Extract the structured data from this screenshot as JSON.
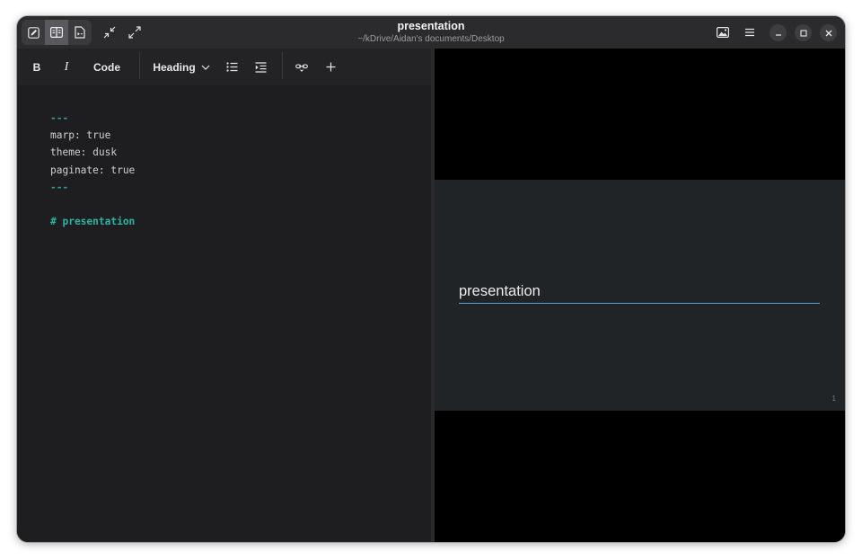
{
  "window": {
    "title": "presentation",
    "subtitle": "~/kDrive/Aidan's documents/Desktop"
  },
  "titlebar": {
    "view_modes": [
      "editor-only",
      "split-view",
      "preview-only"
    ],
    "active_view": "split-view"
  },
  "toolbar": {
    "bold_label": "B",
    "italic_label": "I",
    "code_label": "Code",
    "heading_label": "Heading"
  },
  "editor": {
    "lines": [
      "---",
      "marp: true",
      "theme: dusk",
      "paginate: true",
      "---",
      "",
      "# presentation"
    ]
  },
  "preview": {
    "slide_title": "presentation",
    "page_number": "1"
  },
  "colors": {
    "frontmatter": "#2aa198",
    "heading": "#2bb3a3",
    "slide_underline": "#5aa0d8"
  }
}
